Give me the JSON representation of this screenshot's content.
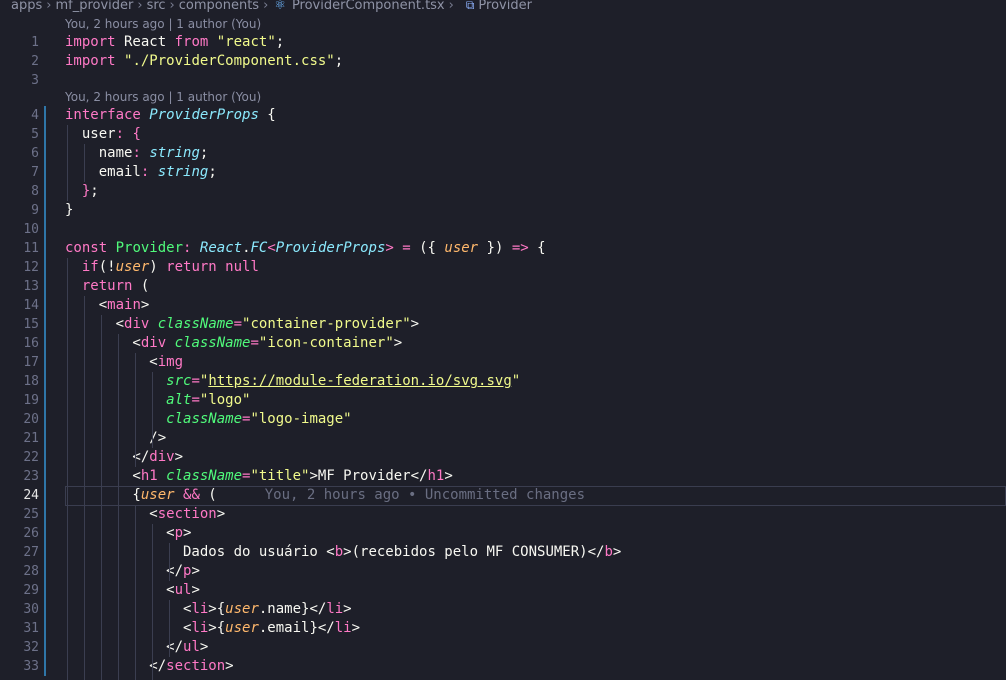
{
  "breadcrumbs": {
    "segments": [
      "apps",
      "mf_provider",
      "src",
      "components"
    ],
    "file": "ProviderComponent.tsx",
    "symbol": "Provider"
  },
  "codelens": {
    "top": "You, 2 hours ago | 1 author (You)",
    "interface": "You, 2 hours ago | 1 author (You)"
  },
  "blame": {
    "line24": "You, 2 hours ago • Uncommitted changes"
  },
  "current_line": 24,
  "lines": [
    {
      "n": "1",
      "t": [
        [
          "kw",
          "import"
        ],
        [
          "p",
          " React "
        ],
        [
          "kw",
          "from"
        ],
        [
          "p",
          " "
        ],
        [
          "str",
          "\"react\""
        ],
        [
          "p",
          ";"
        ]
      ]
    },
    {
      "n": "2",
      "t": [
        [
          "kw",
          "import"
        ],
        [
          "p",
          " "
        ],
        [
          "str",
          "\"./ProviderComponent.css\""
        ],
        [
          "p",
          ";"
        ]
      ]
    },
    {
      "n": "3",
      "t": []
    },
    {
      "n": "4",
      "t": [
        [
          "kw",
          "interface"
        ],
        [
          "p",
          " "
        ],
        [
          "tp",
          "ProviderProps"
        ],
        [
          "p",
          " {"
        ]
      ]
    },
    {
      "n": "5",
      "t": [
        [
          "p",
          "  user"
        ],
        [
          "kw",
          ":"
        ],
        [
          "p",
          " "
        ],
        [
          "kw",
          "{"
        ]
      ]
    },
    {
      "n": "6",
      "t": [
        [
          "p",
          "    name"
        ],
        [
          "kw",
          ":"
        ],
        [
          "p",
          " "
        ],
        [
          "tp",
          "string"
        ],
        [
          "p",
          ";"
        ]
      ]
    },
    {
      "n": "7",
      "t": [
        [
          "p",
          "    email"
        ],
        [
          "kw",
          ":"
        ],
        [
          "p",
          " "
        ],
        [
          "tp",
          "string"
        ],
        [
          "p",
          ";"
        ]
      ]
    },
    {
      "n": "8",
      "t": [
        [
          "p",
          "  "
        ],
        [
          "kw",
          "}"
        ],
        [
          "p",
          ";"
        ]
      ]
    },
    {
      "n": "9",
      "t": [
        [
          "p",
          "}"
        ]
      ]
    },
    {
      "n": "10",
      "t": []
    },
    {
      "n": "11",
      "t": [
        [
          "kw",
          "const"
        ],
        [
          "p",
          " "
        ],
        [
          "fn",
          "Provider"
        ],
        [
          "kw",
          ":"
        ],
        [
          "p",
          " "
        ],
        [
          "tp",
          "React"
        ],
        [
          "p",
          "."
        ],
        [
          "tp",
          "FC"
        ],
        [
          "kw",
          "<"
        ],
        [
          "tp",
          "ProviderProps"
        ],
        [
          "kw",
          "> ="
        ],
        [
          "p",
          " ({ "
        ],
        [
          "var",
          "user"
        ],
        [
          "p",
          " }) "
        ],
        [
          "kw",
          "=>"
        ],
        [
          "p",
          " {"
        ]
      ]
    },
    {
      "n": "12",
      "t": [
        [
          "p",
          "  "
        ],
        [
          "kw",
          "if"
        ],
        [
          "p",
          "(!"
        ],
        [
          "var",
          "user"
        ],
        [
          "p",
          ") "
        ],
        [
          "kw",
          "return"
        ],
        [
          "p",
          " "
        ],
        [
          "kw",
          "null"
        ]
      ]
    },
    {
      "n": "13",
      "t": [
        [
          "p",
          "  "
        ],
        [
          "kw",
          "return"
        ],
        [
          "p",
          " ("
        ]
      ]
    },
    {
      "n": "14",
      "t": [
        [
          "p",
          "    <"
        ],
        [
          "tag",
          "main"
        ],
        [
          "p",
          ">"
        ]
      ]
    },
    {
      "n": "15",
      "t": [
        [
          "p",
          "      <"
        ],
        [
          "tag",
          "div"
        ],
        [
          "p",
          " "
        ],
        [
          "attr",
          "className"
        ],
        [
          "kw",
          "="
        ],
        [
          "str",
          "\"container-provider\""
        ],
        [
          "p",
          ">"
        ]
      ]
    },
    {
      "n": "16",
      "t": [
        [
          "p",
          "        <"
        ],
        [
          "tag",
          "div"
        ],
        [
          "p",
          " "
        ],
        [
          "attr",
          "className"
        ],
        [
          "kw",
          "="
        ],
        [
          "str",
          "\"icon-container\""
        ],
        [
          "p",
          ">"
        ]
      ]
    },
    {
      "n": "17",
      "t": [
        [
          "p",
          "          <"
        ],
        [
          "tag",
          "img"
        ]
      ]
    },
    {
      "n": "18",
      "t": [
        [
          "p",
          "            "
        ],
        [
          "attr",
          "src"
        ],
        [
          "kw",
          "="
        ],
        [
          "str",
          "\""
        ],
        [
          "link",
          "https://module-federation.io/svg.svg"
        ],
        [
          "str",
          "\""
        ]
      ]
    },
    {
      "n": "19",
      "t": [
        [
          "p",
          "            "
        ],
        [
          "attr",
          "alt"
        ],
        [
          "kw",
          "="
        ],
        [
          "str",
          "\"logo\""
        ]
      ]
    },
    {
      "n": "20",
      "t": [
        [
          "p",
          "            "
        ],
        [
          "attr",
          "className"
        ],
        [
          "kw",
          "="
        ],
        [
          "str",
          "\"logo-image\""
        ]
      ]
    },
    {
      "n": "21",
      "t": [
        [
          "p",
          "          />"
        ]
      ]
    },
    {
      "n": "22",
      "t": [
        [
          "p",
          "        </"
        ],
        [
          "tag",
          "div"
        ],
        [
          "p",
          ">"
        ]
      ]
    },
    {
      "n": "23",
      "t": [
        [
          "p",
          "        <"
        ],
        [
          "tag",
          "h1"
        ],
        [
          "p",
          " "
        ],
        [
          "attr",
          "className"
        ],
        [
          "kw",
          "="
        ],
        [
          "str",
          "\"title\""
        ],
        [
          "p",
          ">MF Provider</"
        ],
        [
          "tag",
          "h1"
        ],
        [
          "p",
          ">"
        ]
      ]
    },
    {
      "n": "24",
      "t": [
        [
          "p",
          "        {"
        ],
        [
          "var",
          "user"
        ],
        [
          "p",
          " "
        ],
        [
          "kw",
          "&&"
        ],
        [
          "p",
          " ("
        ]
      ]
    },
    {
      "n": "25",
      "t": [
        [
          "p",
          "          <"
        ],
        [
          "tag",
          "section"
        ],
        [
          "p",
          ">"
        ]
      ]
    },
    {
      "n": "26",
      "t": [
        [
          "p",
          "            <"
        ],
        [
          "tag",
          "p"
        ],
        [
          "p",
          ">"
        ]
      ]
    },
    {
      "n": "27",
      "t": [
        [
          "p",
          "              Dados do usuário <"
        ],
        [
          "tag",
          "b"
        ],
        [
          "p",
          ">(recebidos pelo MF CONSUMER)</"
        ],
        [
          "tag",
          "b"
        ],
        [
          "p",
          ">"
        ]
      ]
    },
    {
      "n": "28",
      "t": [
        [
          "p",
          "            </"
        ],
        [
          "tag",
          "p"
        ],
        [
          "p",
          ">"
        ]
      ]
    },
    {
      "n": "29",
      "t": [
        [
          "p",
          "            <"
        ],
        [
          "tag",
          "ul"
        ],
        [
          "p",
          ">"
        ]
      ]
    },
    {
      "n": "30",
      "t": [
        [
          "p",
          "              <"
        ],
        [
          "tag",
          "li"
        ],
        [
          "p",
          ">{"
        ],
        [
          "var",
          "user"
        ],
        [
          "p",
          ".name}</"
        ],
        [
          "tag",
          "li"
        ],
        [
          "p",
          ">"
        ]
      ]
    },
    {
      "n": "31",
      "t": [
        [
          "p",
          "              <"
        ],
        [
          "tag",
          "li"
        ],
        [
          "p",
          ">{"
        ],
        [
          "var",
          "user"
        ],
        [
          "p",
          ".email}</"
        ],
        [
          "tag",
          "li"
        ],
        [
          "p",
          ">"
        ]
      ]
    },
    {
      "n": "32",
      "t": [
        [
          "p",
          "            </"
        ],
        [
          "tag",
          "ul"
        ],
        [
          "p",
          ">"
        ]
      ]
    },
    {
      "n": "33",
      "t": [
        [
          "p",
          "          </"
        ],
        [
          "tag",
          "section"
        ],
        [
          "p",
          ">"
        ]
      ]
    }
  ],
  "colors": {
    "background": "#1e1f29",
    "keyword": "#ff79c6",
    "string": "#f1fa8c",
    "type": "#8be9fd",
    "attribute": "#50fa7b",
    "parameter": "#ffb86c"
  }
}
